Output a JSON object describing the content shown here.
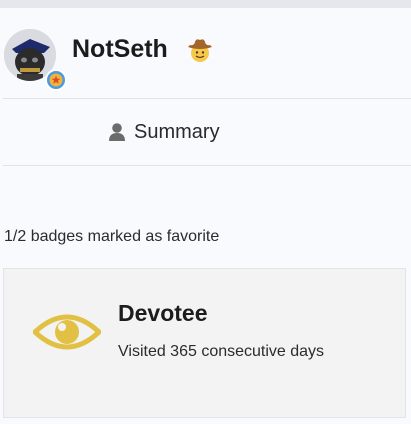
{
  "profile": {
    "username": "NotSeth",
    "avatar_icon": "user-avatar",
    "rank_badge_icon": "star-rank-icon",
    "status_emoji_icon": "cowboy-hat-face-icon"
  },
  "tabs": {
    "summary_label": "Summary",
    "summary_icon": "user-icon"
  },
  "badges": {
    "favorite_count_text": "1/2 badges marked as favorite",
    "items": [
      {
        "name": "Devotee",
        "description": "Visited 365 consecutive days",
        "icon": "eye-icon",
        "color": "#e2c044"
      }
    ]
  },
  "colors": {
    "background": "#f9fafe",
    "card_background": "#f3f3f3",
    "badge_gold": "#e2c044",
    "rank_blue": "#4a9ae0"
  }
}
